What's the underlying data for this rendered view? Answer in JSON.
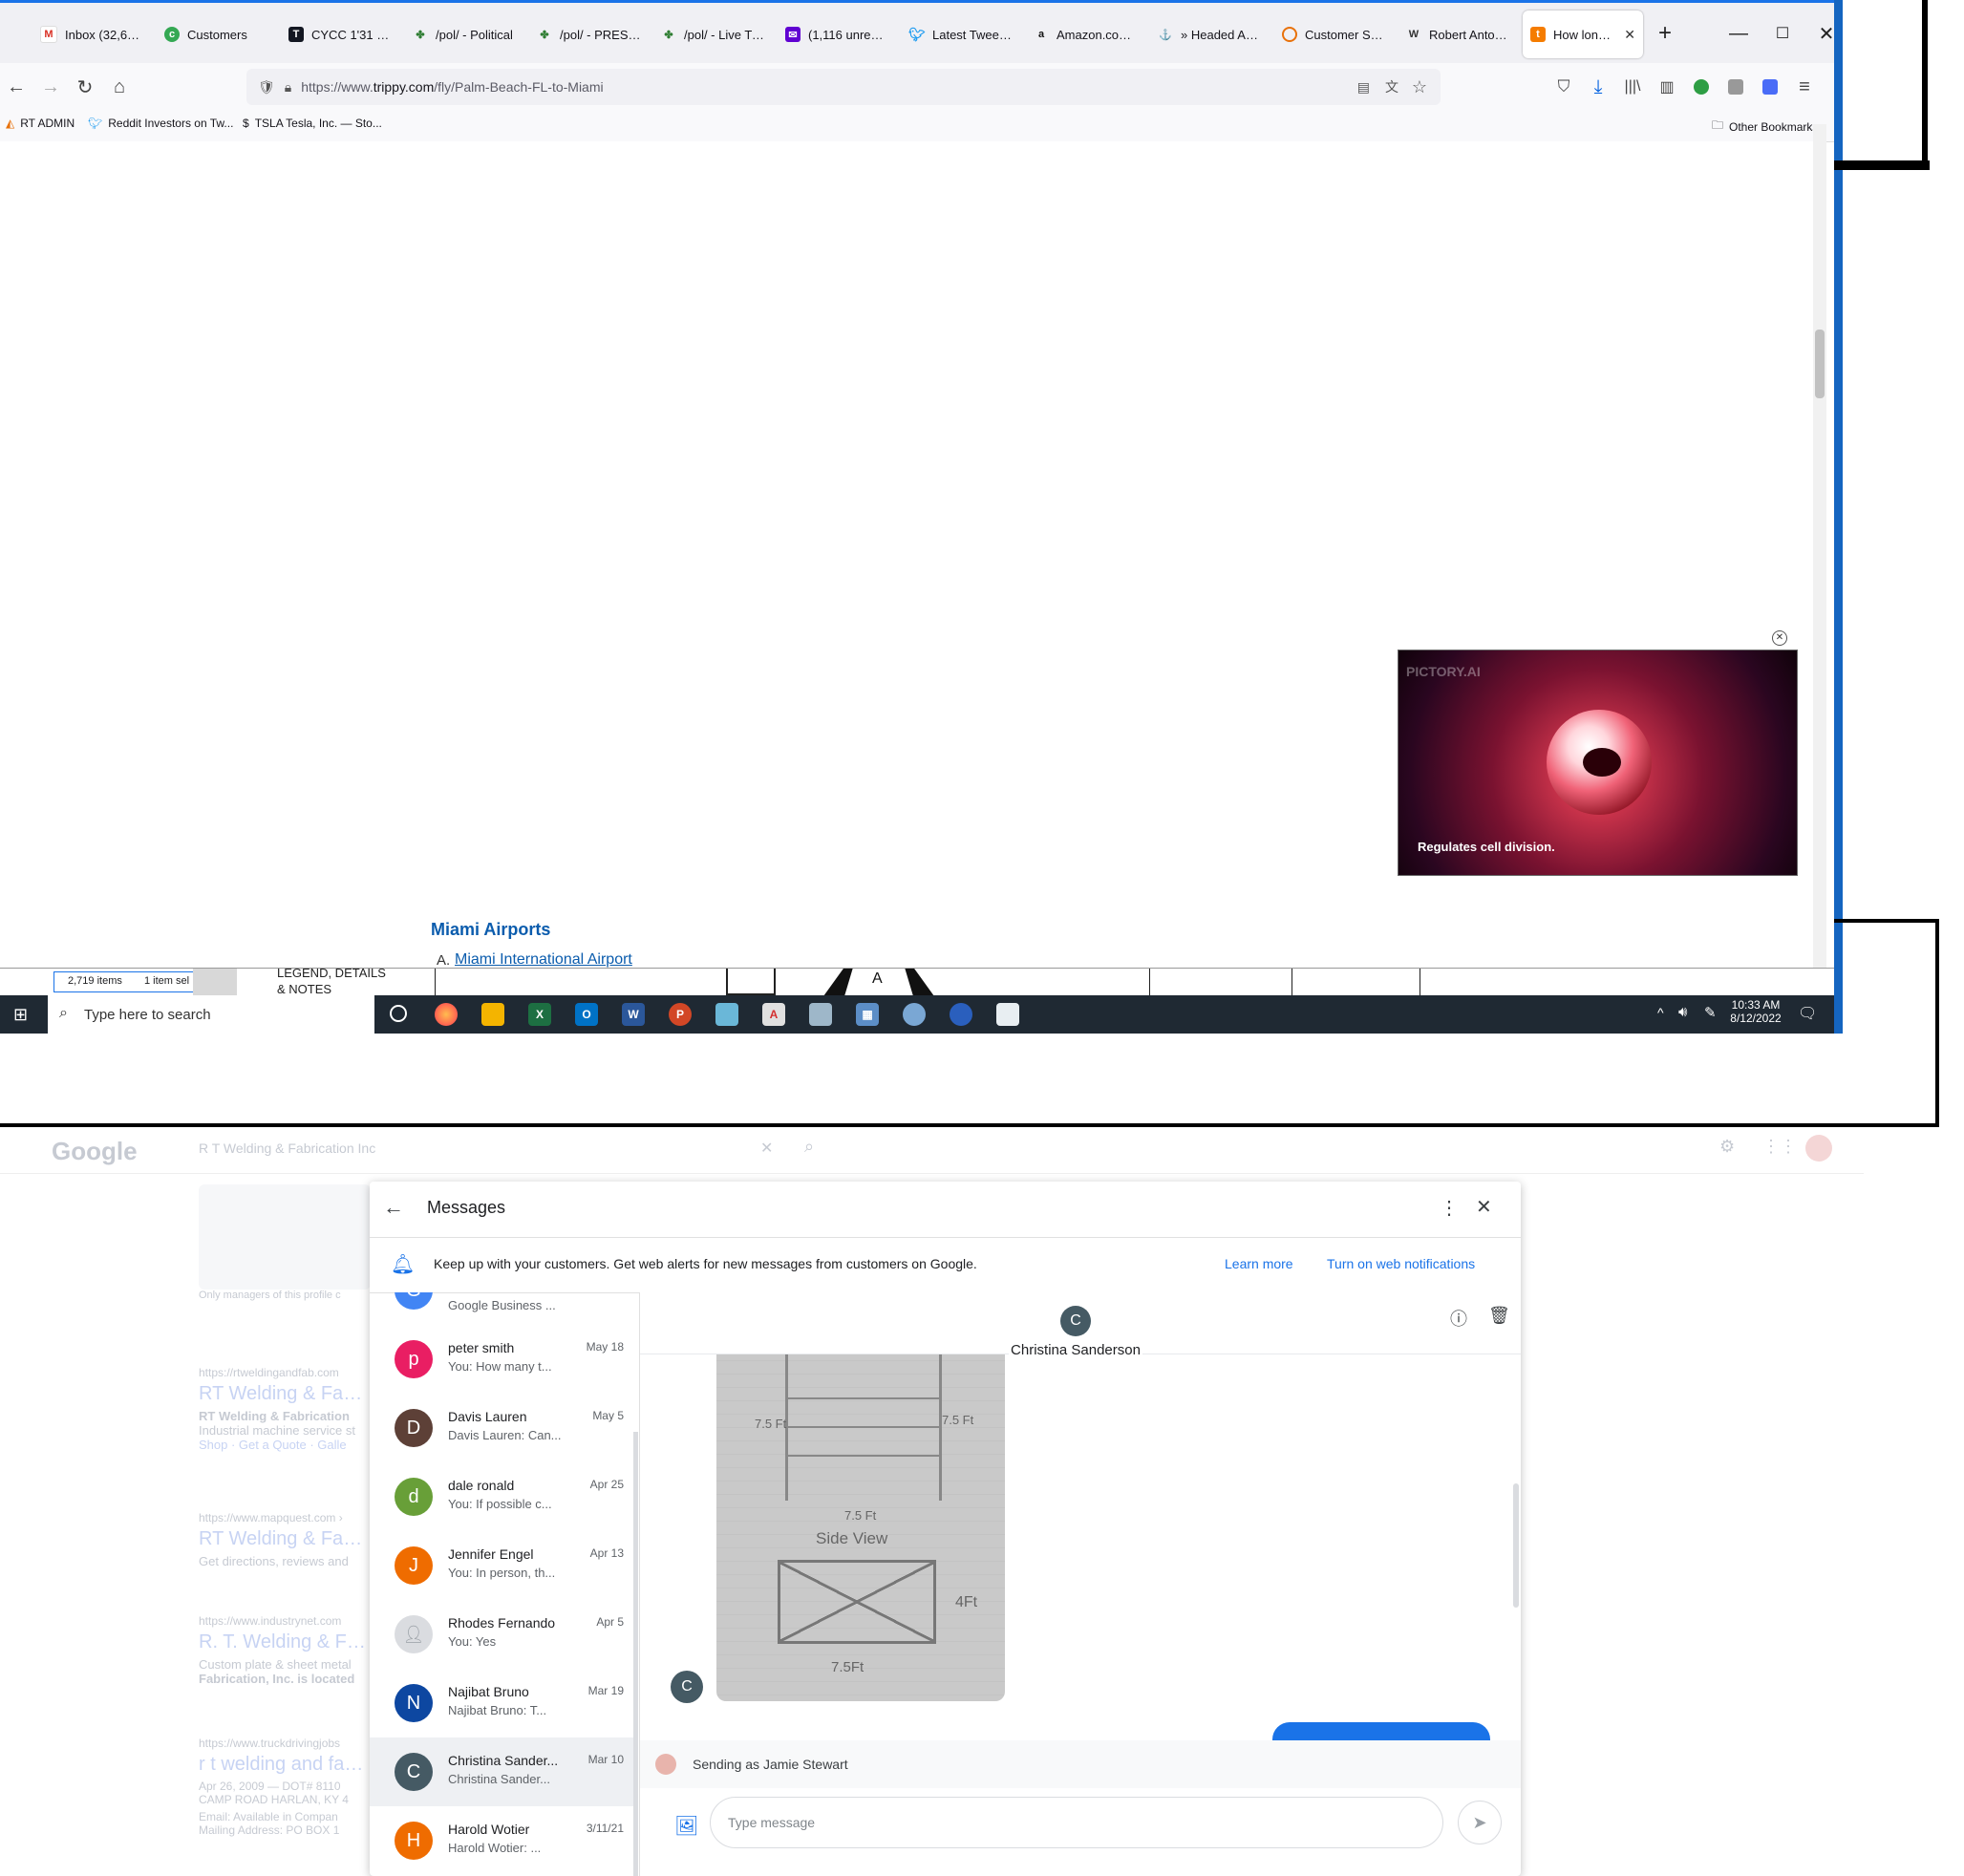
{
  "browser": {
    "tabs": [
      {
        "label": "Inbox (32,688) -",
        "icon": "gmail-icon",
        "color": "#d93025"
      },
      {
        "label": "Customers",
        "icon": "customers-icon",
        "color": "#34a853"
      },
      {
        "label": "CYCC 1'31 ▼ - 1",
        "icon": "tradingview-icon",
        "color": "#131722"
      },
      {
        "label": "/pol/ - Political",
        "icon": "clover-icon",
        "color": "#2e7d32"
      },
      {
        "label": "/pol/ - PRESIDE",
        "icon": "clover-icon",
        "color": "#2e7d32"
      },
      {
        "label": "/pol/ - Live Trun",
        "icon": "clover-icon",
        "color": "#2e7d32"
      },
      {
        "label": "(1,116 unread) -",
        "icon": "mail-icon",
        "color": "#6001d2"
      },
      {
        "label": "Latest Tweets / T",
        "icon": "twitter-icon",
        "color": "#1d9bf0"
      },
      {
        "label": "Amazon.com : s",
        "icon": "amazon-icon",
        "color": "#111111"
      },
      {
        "label": "» Headed Anch",
        "icon": "anchor-icon",
        "color": "#444444"
      },
      {
        "label": "Customer Supp",
        "icon": "support-icon",
        "color": "#e8710a"
      },
      {
        "label": "Robert Anton W",
        "icon": "wikipedia-icon",
        "color": "#333333"
      },
      {
        "label": "How long is t",
        "icon": "trippy-icon",
        "color": "#f57c00"
      }
    ],
    "url_prefix": "https://www.",
    "url_domain": "trippy.com",
    "url_path": "/fly/Palm-Beach-FL-to-Miami",
    "bookmarks": [
      {
        "label": "RT ADMIN",
        "icon": "admin-icon"
      },
      {
        "label": "Reddit Investors on Tw...",
        "icon": "twitter-icon"
      },
      {
        "label": "TSLA Tesla, Inc. — Sto...",
        "icon": "dollar-icon"
      }
    ],
    "other_bookmarks": "Other Bookmarks",
    "video_brand": "PICTORY.AI",
    "video_caption": "Regulates cell division.",
    "section_title": "Miami Airports",
    "airport_prefix": "A.",
    "airport_link": "Miami International Airport",
    "explorer_items": "2,719 items",
    "explorer_selected": "1 item sel",
    "legend_line1": "LEGEND, DETAILS",
    "legend_line2": "& NOTES",
    "drawing_letter": "A",
    "taskbar": {
      "search_placeholder": "Type here to search",
      "time": "10:33 AM",
      "date": "8/12/2022"
    }
  },
  "background_page": {
    "logo": "Google",
    "search_value": "R T Welding & Fabrication Inc",
    "note": "Only managers of this profile c",
    "results": [
      {
        "url": "https://rtweldingandfab.com",
        "title": "RT Welding & Fabric",
        "snippet1": "RT Welding & Fabrication",
        "snippet2": "Industrial machine service st",
        "links": "Shop · Get a Quote · Galle"
      },
      {
        "url": "https://www.mapquest.com ›",
        "title": "RT Welding & Fabric",
        "snippet1": "Get directions, reviews and"
      },
      {
        "url": "https://www.industrynet.com",
        "title": "R. T. Welding & Fabr",
        "snippet1": "Custom plate & sheet metal",
        "snippet2": "Fabrication, Inc. is located"
      },
      {
        "url": "https://www.truckdrivingjobs",
        "title": "r t welding and fabric",
        "snippet1": "Apr 26, 2009 — DOT# 8110",
        "snippet2": "CAMP ROAD HARLAN, KY 4",
        "snippet3": "Email: Available in Compan",
        "snippet4": "Mailing Address: PO BOX 1"
      }
    ]
  },
  "messages": {
    "title": "Messages",
    "notice": "Keep up with your customers. Get web alerts for new messages from customers on Google.",
    "learn_more": "Learn more",
    "turn_on": "Turn on web notifications",
    "contacts": [
      {
        "initial": "G",
        "name": "",
        "preview": "Google Business ...",
        "date": "",
        "color": "#4285f4"
      },
      {
        "initial": "p",
        "name": "peter smith",
        "preview": "You: How many t...",
        "date": "May 18",
        "color": "#e91e63"
      },
      {
        "initial": "D",
        "name": "Davis Lauren",
        "preview": "Davis Lauren: Can...",
        "date": "May 5",
        "color": "#5d4037"
      },
      {
        "initial": "d",
        "name": "dale ronald",
        "preview": "You: If possible c...",
        "date": "Apr 25",
        "color": "#689f38"
      },
      {
        "initial": "J",
        "name": "Jennifer Engel",
        "preview": "You: In person, th...",
        "date": "Apr 13",
        "color": "#ef6c00"
      },
      {
        "initial": "",
        "name": "Rhodes Fernando",
        "preview": "You: Yes",
        "date": "Apr 5",
        "color": "#dadce0"
      },
      {
        "initial": "N",
        "name": "Najibat Bruno",
        "preview": "Najibat Bruno: T...",
        "date": "Mar 19",
        "color": "#0d47a1"
      },
      {
        "initial": "C",
        "name": "Christina Sander...",
        "preview": "Christina Sander...",
        "date": "Mar 10",
        "color": "#455a64"
      },
      {
        "initial": "H",
        "name": "Harold Wotier",
        "preview": "Harold Wotier: ...",
        "date": "3/11/21",
        "color": "#ef6c00"
      }
    ],
    "active_contact": {
      "initial": "C",
      "name": "Christina Sanderson",
      "color": "#455a64"
    },
    "sketch": {
      "left_dim": "7.5 Ft",
      "right_dim": "7.5 Ft",
      "mid_dim": "7.5 Ft",
      "side_view": "Side View",
      "height_dim": "4Ft",
      "bottom_dim": "7.5Ft"
    },
    "sending_as": "Sending as Jamie Stewart",
    "input_placeholder": "Type message"
  }
}
